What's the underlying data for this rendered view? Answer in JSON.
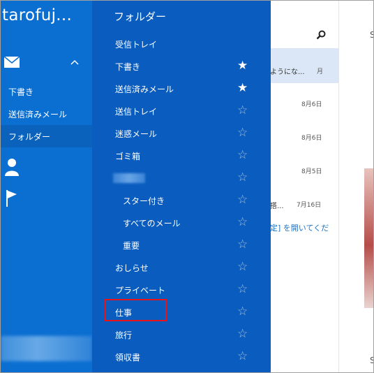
{
  "left_nav": {
    "account_name": "tarofuj...",
    "items": [
      {
        "label": "下書き"
      },
      {
        "label": "送信済みメール"
      },
      {
        "label": "フォルダー"
      }
    ]
  },
  "folder_flyout": {
    "title": "フォルダー",
    "folders": [
      {
        "label": "受信トレイ",
        "star": "",
        "indent": 0
      },
      {
        "label": "下書き",
        "star": "★",
        "indent": 0
      },
      {
        "label": "送信済みメール",
        "star": "★",
        "indent": 0
      },
      {
        "label": "送信トレイ",
        "star": "☆",
        "indent": 0
      },
      {
        "label": "迷惑メール",
        "star": "☆",
        "indent": 0
      },
      {
        "label": "ゴミ箱",
        "star": "☆",
        "indent": 0
      },
      {
        "label": "",
        "star": "☆",
        "indent": 0,
        "blurred": true
      },
      {
        "label": "スター付き",
        "star": "☆",
        "indent": 1
      },
      {
        "label": "すべてのメール",
        "star": "☆",
        "indent": 1
      },
      {
        "label": "重要",
        "star": "☆",
        "indent": 1
      },
      {
        "label": "おしらせ",
        "star": "☆",
        "indent": 0
      },
      {
        "label": "プライベート",
        "star": "☆",
        "indent": 0
      },
      {
        "label": "仕事",
        "star": "☆",
        "indent": 0,
        "highlighted": true
      },
      {
        "label": "旅行",
        "star": "☆",
        "indent": 0
      },
      {
        "label": "領収書",
        "star": "☆",
        "indent": 0
      }
    ]
  },
  "message_list": {
    "rows": [
      {
        "text": "ようにな...",
        "date": "月"
      },
      {
        "text": "",
        "date": "8月6日"
      },
      {
        "text": "",
        "date": "8月6日"
      },
      {
        "text": "",
        "date": "8月5日"
      },
      {
        "text": "搭...",
        "date": "7月16日"
      }
    ],
    "link_text": "定] を開いてくだ"
  },
  "preview": {
    "letters": [
      "S",
      "S"
    ]
  },
  "colors": {
    "left_nav_bg": "#0b6ed1",
    "flyout_bg": "#0a5cbe",
    "highlight_box": "#e8141c"
  }
}
